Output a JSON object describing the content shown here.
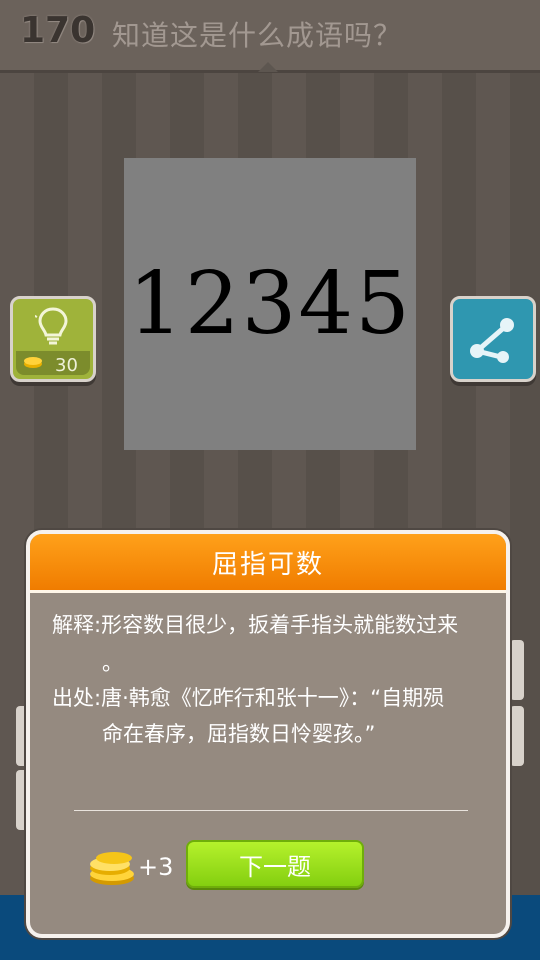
{
  "header": {
    "level": "170",
    "question": "知道这是什么成语吗？"
  },
  "puzzle": {
    "text": "12345"
  },
  "hint_button": {
    "icon": "lightbulb-icon",
    "cost": "30"
  },
  "share_button": {
    "icon": "share-icon"
  },
  "dialog": {
    "title": "屈指可数",
    "definition_label": "解释:",
    "definition_line1": "形容数目很少，扳着手指头就能数过来",
    "definition_line2": "。",
    "source_label": "出处:",
    "source_line1": "唐·韩愈《忆昨行和张十一》：“自期殒",
    "source_line2": "命在春序，屈指数日怜婴孩。”",
    "reward": "+3",
    "next_label": "下一题"
  },
  "colors": {
    "header_orange": "#f08c00",
    "next_green": "#9ee01e",
    "hint_green": "#9fb33a",
    "share_blue": "#2f97b0"
  }
}
